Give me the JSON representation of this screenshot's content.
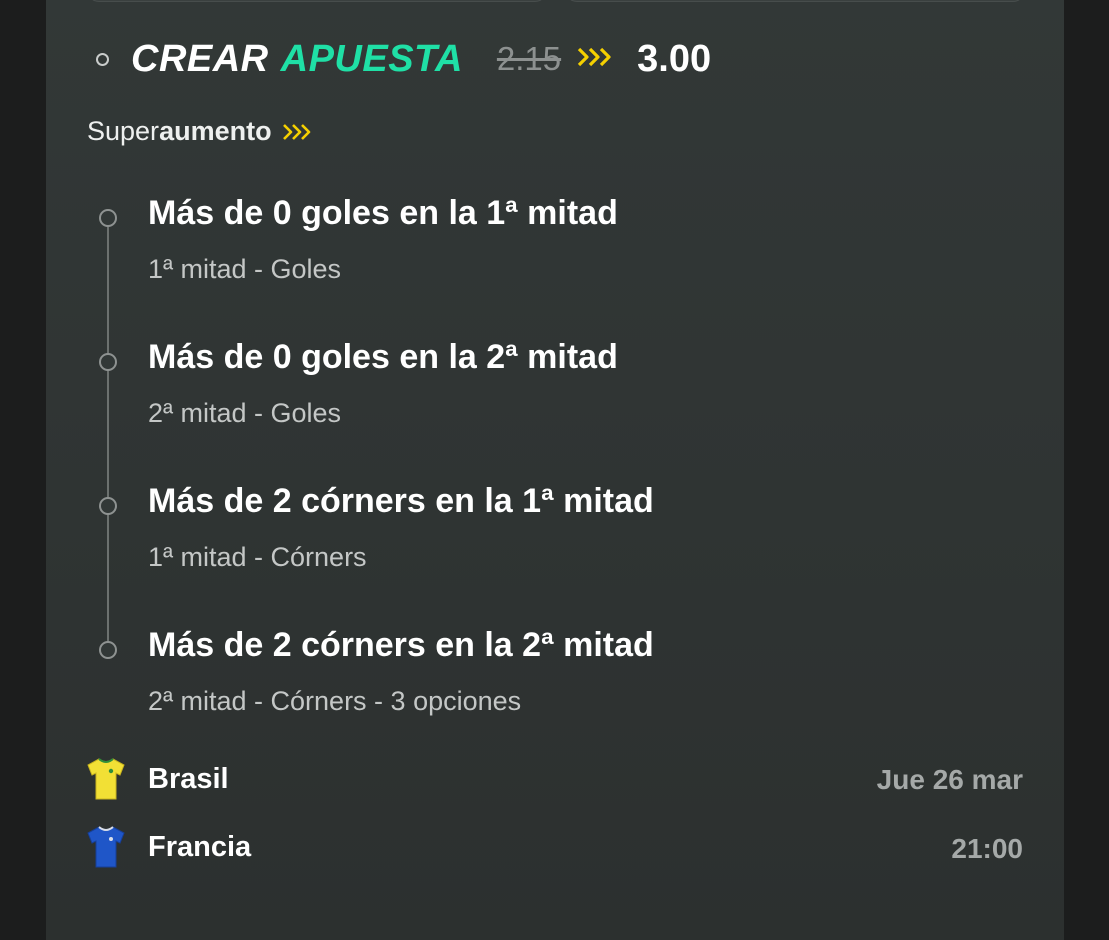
{
  "header": {
    "title_part1": "CREAR",
    "title_part2": "APUESTA",
    "old_odds": "2.15",
    "new_odds": "3.00"
  },
  "boost": {
    "prefix": "Super",
    "suffix": "aumento"
  },
  "legs": [
    {
      "title": "Más de 0 goles en la 1ª mitad",
      "subtitle": "1ª mitad - Goles"
    },
    {
      "title": "Más de 0 goles en la 2ª mitad",
      "subtitle": "2ª mitad - Goles"
    },
    {
      "title": "Más de 2 córners en la 1ª mitad",
      "subtitle": "1ª mitad - Córners"
    },
    {
      "title": "Más de 2 córners en la 2ª mitad",
      "subtitle": "2ª mitad - Córners - 3 opciones"
    }
  ],
  "match": {
    "home": "Brasil",
    "away": "Francia",
    "date": "Jue 26 mar",
    "time": "21:00"
  },
  "colors": {
    "accent_green": "#1fe0a6",
    "boost_yellow": "#f5d000",
    "card_background": "#323837",
    "home_shirt": "#f2e035",
    "away_shirt": "#1f56c8"
  },
  "icons": {
    "boost": "triple-chevron-right-icon",
    "home_shirt": "yellow-shirt-icon",
    "away_shirt": "blue-shirt-icon"
  }
}
